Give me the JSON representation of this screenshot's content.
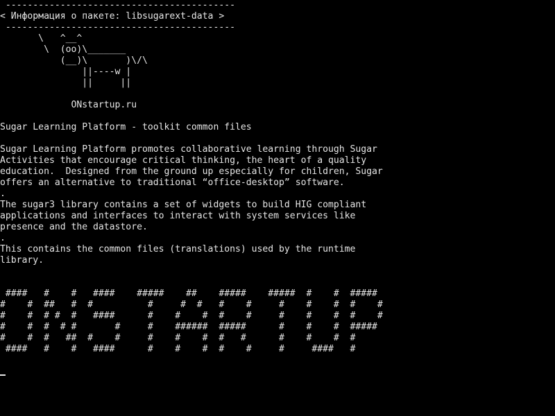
{
  "cowsay": {
    "top_border": " ------------------------------------------",
    "message": "< Информация о пакете: libsugarext-data >",
    "bottom_border": " ------------------------------------------",
    "cow": "       \\   ^__^\n        \\  (oo)\\_______\n           (__)\\       )\\/\\\n               ||----w |\n               ||     ||"
  },
  "site": "             ONstartup.ru",
  "package": {
    "summary": "Sugar Learning Platform - toolkit common files",
    "description": "Sugar Learning Platform promotes collaborative learning through Sugar\nActivities that encourage critical thinking, the heart of a quality\neducation.  Designed from the ground up especially for children, Sugar\noffers an alternative to traditional “office-desktop” software.\n.\nThe sugar3 library contains a set of widgets to build HIG compliant\napplications and interfaces to interact with system services like\npresence and the datastore.\n.\nThis contains the common files (translations) used by the runtime\nlibrary."
  },
  "banner": " ####   #    #   ####    #####    ##    #####    #####  #    #  #####\n#    #  ##   #  #          #     #  #   #    #     #    #    #  #    #\n#    #  # #  #   ####      #    #    #  #    #     #    #    #  #    #\n#    #  #  # #       #     #    ######  #####      #    #    #  #####\n#    #  #   ##  #    #     #    #    #  #   #      #    #    #  #\n ####   #    #   ####      #    #    #  #    #     #     ####   #"
}
